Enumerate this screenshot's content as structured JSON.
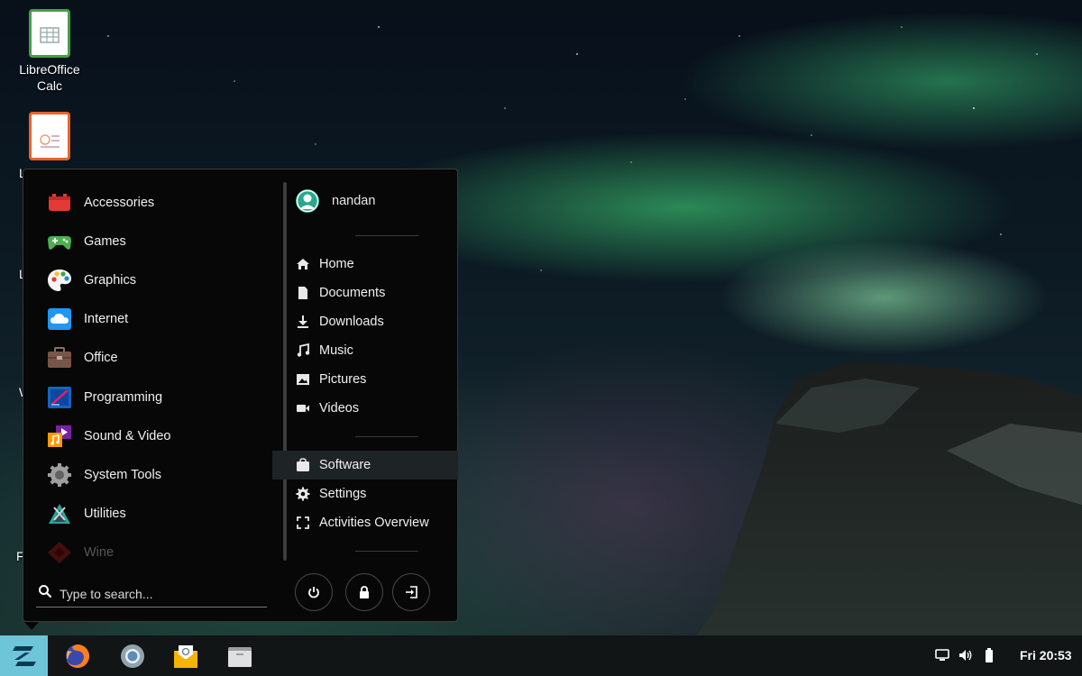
{
  "desktop": {
    "icons": [
      {
        "label": "LibreOffice\nCalc"
      }
    ],
    "partial_labels": [
      "L",
      "L",
      "W",
      "F"
    ]
  },
  "menu": {
    "categories": [
      {
        "label": "Accessories",
        "icon": "accessories-icon"
      },
      {
        "label": "Games",
        "icon": "gamepad-icon"
      },
      {
        "label": "Graphics",
        "icon": "palette-icon"
      },
      {
        "label": "Internet",
        "icon": "cloud-icon"
      },
      {
        "label": "Office",
        "icon": "briefcase-icon"
      },
      {
        "label": "Programming",
        "icon": "programming-icon"
      },
      {
        "label": "Sound & Video",
        "icon": "music-icon"
      },
      {
        "label": "System Tools",
        "icon": "gear-icon"
      },
      {
        "label": "Utilities",
        "icon": "utilities-icon"
      },
      {
        "label": "Wine",
        "icon": "wine-icon"
      }
    ],
    "search_placeholder": "Type to search...",
    "user": {
      "name": "nandan"
    },
    "places": [
      {
        "label": "Home",
        "icon": "home-icon"
      },
      {
        "label": "Documents",
        "icon": "document-icon"
      },
      {
        "label": "Downloads",
        "icon": "download-icon"
      },
      {
        "label": "Music",
        "icon": "music-note-icon"
      },
      {
        "label": "Pictures",
        "icon": "image-icon"
      },
      {
        "label": "Videos",
        "icon": "video-icon"
      }
    ],
    "system": [
      {
        "label": "Software",
        "icon": "software-bag-icon"
      },
      {
        "label": "Settings",
        "icon": "settings-gear-icon"
      },
      {
        "label": "Activities Overview",
        "icon": "overview-icon"
      }
    ],
    "buttons": [
      "power-icon",
      "lock-icon",
      "logout-icon"
    ]
  },
  "taskbar": {
    "apps": [
      "firefox-icon",
      "chromium-icon",
      "mail-icon",
      "files-icon"
    ],
    "tray": [
      "display-icon",
      "volume-icon",
      "battery-icon"
    ],
    "clock": "Fri 20:53"
  },
  "colors": {
    "accent": "#6ec5d8",
    "menu_bg": "#070707",
    "user_avatar": "#29a88c"
  }
}
